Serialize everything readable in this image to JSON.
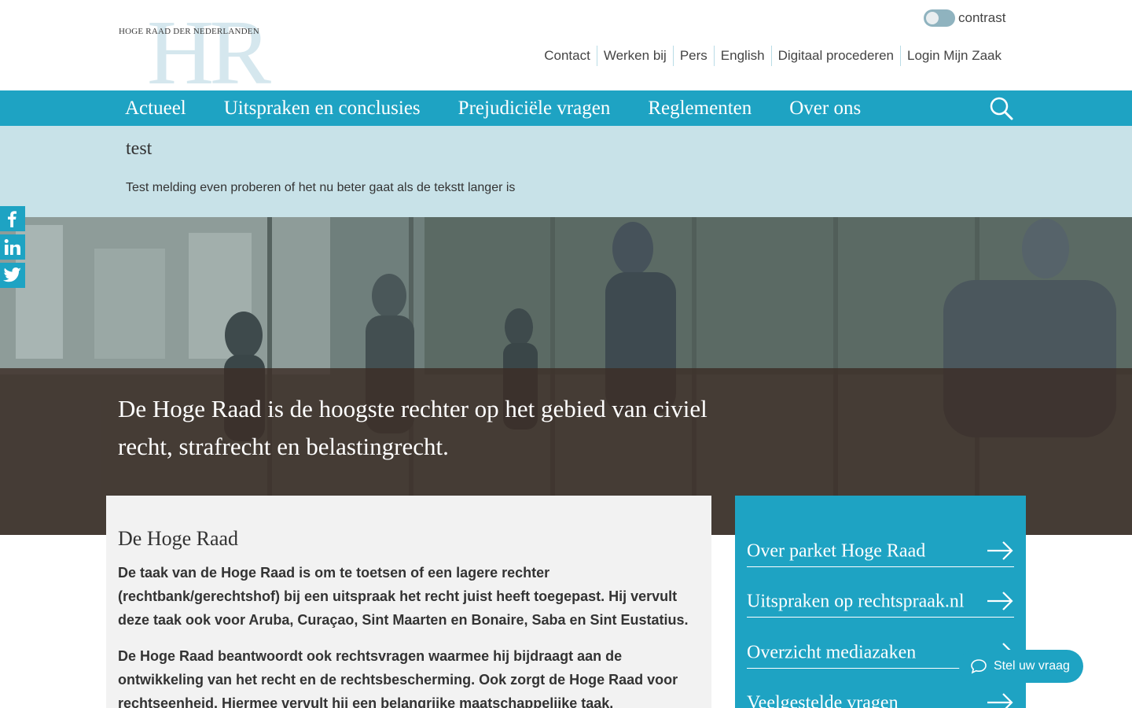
{
  "logo": {
    "monogram": "HR",
    "name": "HOGE RAAD DER NEDERLANDEN"
  },
  "contrast": {
    "label": "contrast"
  },
  "topnav": [
    "Contact",
    "Werken bij",
    "Pers",
    "English",
    "Digitaal procederen",
    "Login Mijn Zaak"
  ],
  "mainnav": [
    "Actueel",
    "Uitspraken en conclusies",
    "Prejudiciële vragen",
    "Reglementen",
    "Over ons"
  ],
  "notice": {
    "title": "test",
    "text": "Test melding even proberen of het nu beter gaat als de tekstt langer is"
  },
  "hero": {
    "text": "De Hoge Raad is de hoogste rechter op het gebied van civiel recht, strafrecht en belastingrecht."
  },
  "social": [
    "facebook-icon",
    "linkedin-icon",
    "twitter-icon"
  ],
  "card": {
    "title": "De Hoge Raad",
    "p1": "De taak van de Hoge Raad is om te toetsen of een lagere rechter (rechtbank/gerechtshof) bij een uitspraak het recht juist heeft toegepast. Hij vervult deze taak ook voor Aruba, Curaçao, Sint Maarten en Bonaire, Saba en Sint Eustatius.",
    "p2": "De Hoge Raad beantwoordt ook rechtsvragen waarmee hij bijdraagt aan de ontwikkeling van het recht en de rechtsbescherming. Ook zorgt de Hoge Raad voor rechtseenheid. Hiermee vervult hij een belangrijke maatschappelijke taak."
  },
  "sidelinks": [
    "Over parket Hoge Raad",
    "Uitspraken op rechtspraak.nl",
    "Overzicht mediazaken",
    "Veelgestelde vragen"
  ],
  "chat": {
    "label": "Stel uw vraag"
  },
  "colors": {
    "accent": "#1ea3c3",
    "notice_bg": "#c8e2e8",
    "hero_band": "#3c2d26"
  }
}
